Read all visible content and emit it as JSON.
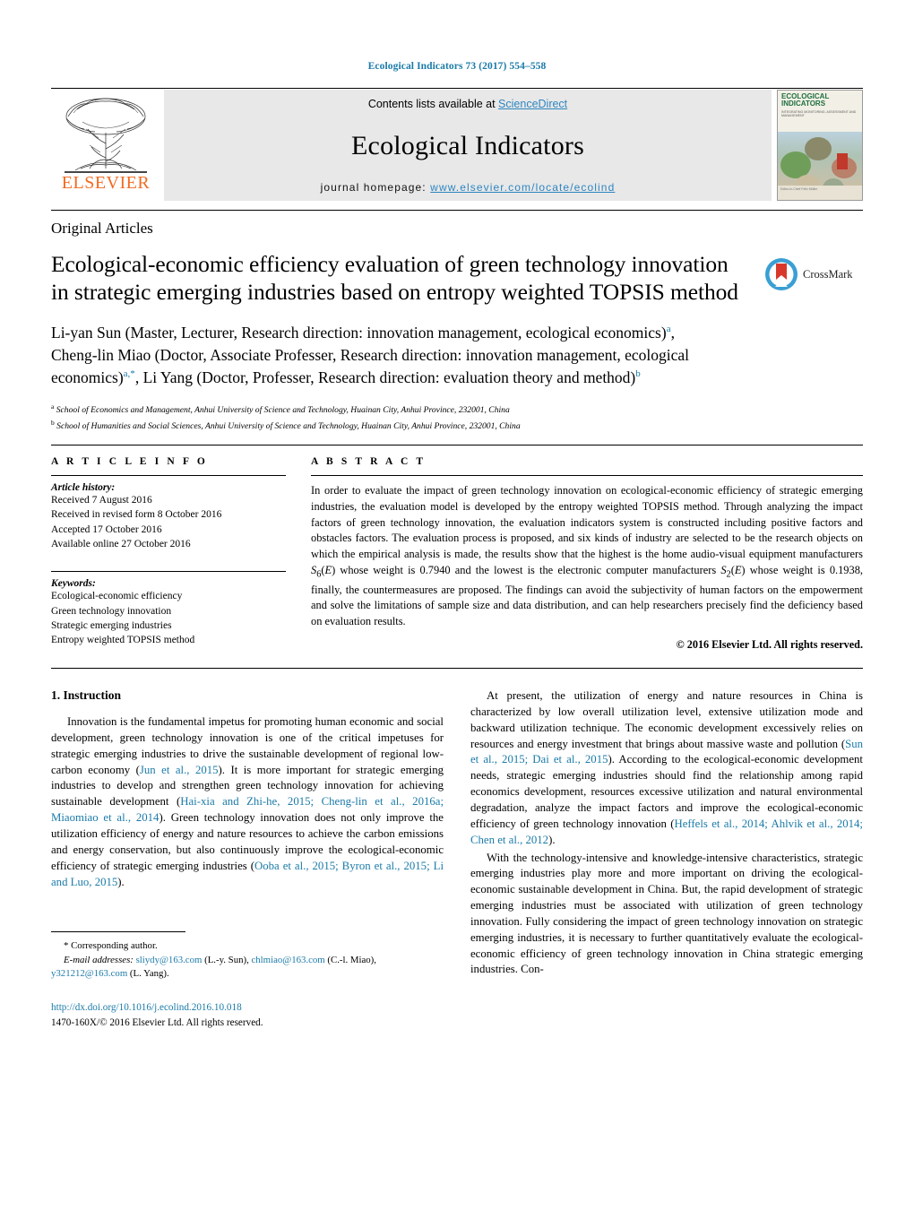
{
  "running_head": "Ecological Indicators 73 (2017) 554–558",
  "masthead": {
    "publisher_logo_text": "ELSEVIER",
    "contents_prefix": "Contents lists available at ",
    "contents_link": "ScienceDirect",
    "journal_name": "Ecological Indicators",
    "homepage_label": "journal homepage: ",
    "homepage_url": "www.elsevier.com/locate/ecolind",
    "cover": {
      "title": "ECOLOGICAL INDICATORS",
      "subtitle": "INTEGRATING MONITORING, ASSESSMENT AND MANAGEMENT",
      "footer": "Editor-in-Chief\nFelix Müller"
    }
  },
  "article_type": "Original Articles",
  "title": "Ecological-economic efficiency evaluation of green technology innovation in strategic emerging industries based on entropy weighted TOPSIS method",
  "crossmark_label": "CrossMark",
  "authors_html": "Li-yan Sun (Master, Lecturer, Research direction: innovation management, ecological economics)<sup class=\"sup-a\">a</sup>, Cheng-lin Miao (Doctor, Associate Professer, Research direction: innovation management, ecological economics)<sup class=\"sup-a\">a,*</sup>, Li Yang (Doctor, Professer, Research direction: evaluation theory and method)<sup class=\"sup-a\">b</sup>",
  "affiliations": [
    {
      "mark": "a",
      "text": "School of Economics and Management, Anhui University of Science and Technology, Huainan City, Anhui Province, 232001, China"
    },
    {
      "mark": "b",
      "text": "School of Humanities and Social Sciences, Anhui University of Science and Technology, Huainan City, Anhui Province, 232001, China"
    }
  ],
  "article_info": {
    "heading": "A R T I C L E  I N F O",
    "history_label": "Article history:",
    "history": [
      "Received 7 August 2016",
      "Received in revised form 8 October 2016",
      "Accepted 17 October 2016",
      "Available online 27 October 2016"
    ],
    "keywords_label": "Keywords:",
    "keywords": [
      "Ecological-economic efficiency",
      "Green technology innovation",
      "Strategic emerging industries",
      "Entropy weighted TOPSIS method"
    ]
  },
  "abstract": {
    "heading": "A B S T R A C T",
    "text_html": "In order to evaluate the impact of green technology innovation on ecological-economic efficiency of strategic emerging industries, the evaluation model is developed by the entropy weighted TOPSIS method. Through analyzing the impact factors of green technology innovation, the evaluation indicators system is constructed including positive factors and obstacles factors. The evaluation process is proposed, and six kinds of industry are selected to be the research objects on which the empirical analysis is made, the results show that the highest is the home audio-visual equipment manufacturers <span class=\"ital\">S</span><sub>6</sub>(<span class=\"ital\">E</span>) whose weight is 0.7940 and the lowest is the electronic computer manufacturers <span class=\"ital\">S</span><sub>2</sub>(<span class=\"ital\">E</span>) whose weight is 0.1938, finally, the countermeasures are proposed. The findings can avoid the subjectivity of human factors on the empowerment and solve the limitations of sample size and data distribution, and can help researchers precisely find the deficiency based on evaluation results.",
    "copyright": "© 2016 Elsevier Ltd. All rights reserved."
  },
  "body": {
    "section_number_title": "1. Instruction",
    "left_paragraphs_html": [
      "Innovation is the fundamental impetus for promoting human economic and social development, green technology innovation is one of the critical impetuses for strategic emerging industries to drive the sustainable development of regional low-carbon economy (<span class=\"ref\">Jun et al., 2015</span>). It is more important for strategic emerging industries to develop and strengthen green technology innovation for achieving sustainable development (<span class=\"ref\">Hai-xia and Zhi-he, 2015; Cheng-lin et al., 2016a; Miaomiao et al., 2014</span>). Green technology innovation does not only improve the utilization efficiency of energy and nature resources to achieve the carbon emissions and energy conservation, but also continuously improve the ecological-economic efficiency of strategic emerging industries (<span class=\"ref\">Ooba et al., 2015; Byron et al., 2015; Li and Luo, 2015</span>)."
    ],
    "right_paragraphs_html": [
      "At present, the utilization of energy and nature resources in China is characterized by low overall utilization level, extensive utilization mode and backward utilization technique. The economic development excessively relies on resources and energy investment that brings about massive waste and pollution (<span class=\"ref\">Sun et al., 2015; Dai et al., 2015</span>). According to the ecological-economic development needs, strategic emerging industries should find the relationship among rapid economics development, resources excessive utilization and natural environmental degradation, analyze the impact factors and improve the ecological-economic efficiency of green technology innovation (<span class=\"ref\">Heffels et al., 2014; Ahlvik et al., 2014; Chen et al., 2012</span>).",
      "With the technology-intensive and knowledge-intensive characteristics, strategic emerging industries play more and more important on driving the ecological-economic sustainable development in China. But, the rapid development of strategic emerging industries must be associated with utilization of green technology innovation. Fully considering the impact of green technology innovation on strategic emerging industries, it is necessary to further quantitatively evaluate the ecological-economic efficiency of green technology innovation in China strategic emerging industries. Con-"
    ]
  },
  "footnotes": {
    "corresponding": "* Corresponding author.",
    "emails_html": "<span class=\"ital\">E-mail addresses:</span> <span class=\"ref\">sliydy@163.com</span> (L.-y. Sun), <span class=\"ref\">chlmiao@163.com</span> (C.-l. Miao), <span class=\"ref\">y321212@163.com</span> (L. Yang).",
    "doi": "http://dx.doi.org/10.1016/j.ecolind.2016.10.018",
    "issn_line": "1470-160X/© 2016 Elsevier Ltd. All rights reserved."
  },
  "colors": {
    "link_blue": "#1a7aa8",
    "science_direct_blue": "#2e86c1",
    "elsevier_orange": "#f26b21"
  }
}
